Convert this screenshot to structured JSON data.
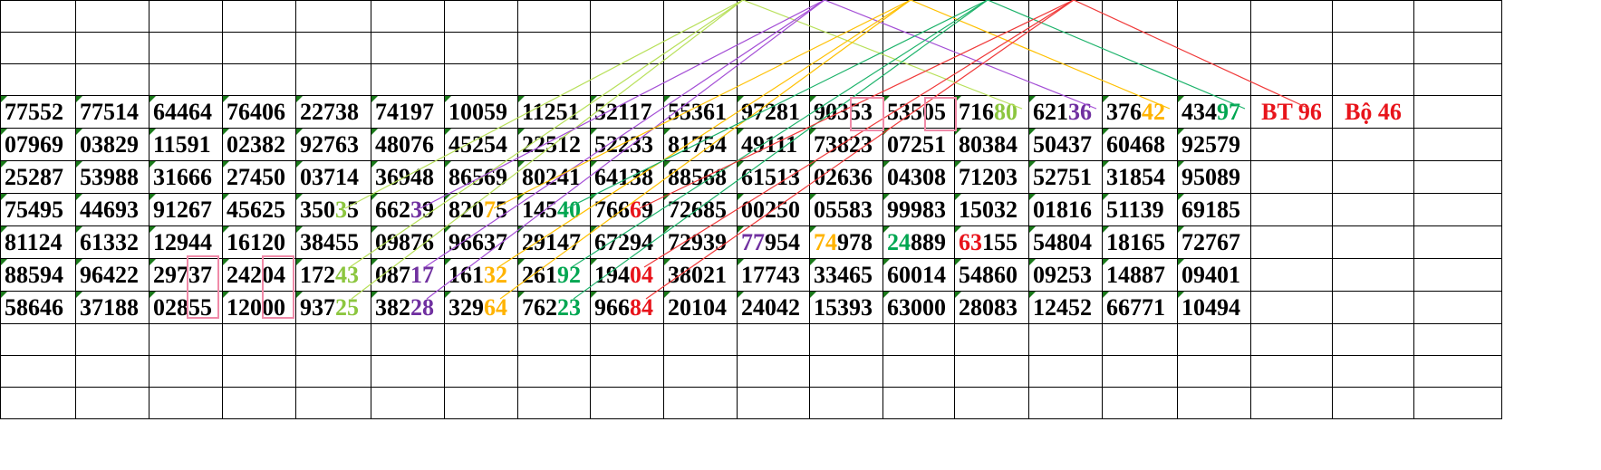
{
  "sheet": {
    "label_bt": "BT 96",
    "label_bo": "Bộ 46",
    "rows": [
      [
        [
          "77552"
        ],
        [
          "77514"
        ],
        [
          "64464"
        ],
        [
          "76406"
        ],
        [
          "22738"
        ],
        [
          "74197"
        ],
        [
          "10059"
        ],
        [
          "11251"
        ],
        [
          "52117"
        ],
        [
          "55361"
        ],
        [
          "97281"
        ],
        [
          "90353"
        ],
        [
          "53505"
        ],
        [
          "716",
          "80",
          "green"
        ],
        [
          "621",
          "36",
          "purple"
        ],
        [
          "376",
          "42",
          "orange"
        ],
        [
          "434",
          "97",
          "dkgreen"
        ]
      ],
      [
        [
          "07969"
        ],
        [
          "03829"
        ],
        [
          "11591"
        ],
        [
          "02382"
        ],
        [
          "92763"
        ],
        [
          "48076"
        ],
        [
          "45254"
        ],
        [
          "22512"
        ],
        [
          "52233"
        ],
        [
          "81754"
        ],
        [
          "49111"
        ],
        [
          "73823"
        ],
        [
          "07251"
        ],
        [
          "80384"
        ],
        [
          "50437"
        ],
        [
          "60468"
        ],
        [
          "92579"
        ]
      ],
      [
        [
          "25287"
        ],
        [
          "53988"
        ],
        [
          "31666"
        ],
        [
          "27450"
        ],
        [
          "03714"
        ],
        [
          "36948"
        ],
        [
          "86569"
        ],
        [
          "80241"
        ],
        [
          "64138"
        ],
        [
          "88568"
        ],
        [
          "61513"
        ],
        [
          "02636"
        ],
        [
          "04308"
        ],
        [
          "71203"
        ],
        [
          "52751"
        ],
        [
          "31854"
        ],
        [
          "95089"
        ]
      ],
      [
        [
          "75495"
        ],
        [
          "44693"
        ],
        [
          "91267"
        ],
        [
          "45625"
        ],
        [
          "350",
          "3",
          "green",
          "5"
        ],
        [
          "662",
          "3",
          "purple",
          "9"
        ],
        [
          "820",
          "7",
          "orange",
          "5"
        ],
        [
          "145",
          "40",
          "dkgreen"
        ],
        [
          "766",
          "6",
          "red",
          "9"
        ],
        [
          "72685"
        ],
        [
          "00250"
        ],
        [
          "05583"
        ],
        [
          "99983"
        ],
        [
          "15032"
        ],
        [
          "01816"
        ],
        [
          "51139"
        ],
        [
          "69185"
        ]
      ],
      [
        [
          "81124"
        ],
        [
          "61332"
        ],
        [
          "12944"
        ],
        [
          "16120"
        ],
        [
          "38455"
        ],
        [
          "09876"
        ],
        [
          "96637"
        ],
        [
          "29147"
        ],
        [
          "67294"
        ],
        [
          "72939"
        ],
        [
          "",
          "77",
          "purple",
          "954"
        ],
        [
          "",
          "74",
          "orange",
          "978"
        ],
        [
          "",
          "24",
          "dkgreen",
          "889"
        ],
        [
          "",
          "63",
          "red",
          "155"
        ],
        [
          "54804"
        ],
        [
          "18165"
        ],
        [
          "72767"
        ]
      ],
      [
        [
          "88594"
        ],
        [
          "96422"
        ],
        [
          "29737"
        ],
        [
          "24204"
        ],
        [
          "172",
          "43",
          "green"
        ],
        [
          "087",
          "17",
          "purple"
        ],
        [
          "161",
          "32",
          "orange"
        ],
        [
          "261",
          "92",
          "dkgreen"
        ],
        [
          "194",
          "04",
          "red"
        ],
        [
          "38021"
        ],
        [
          "17743"
        ],
        [
          "33465"
        ],
        [
          "60014"
        ],
        [
          "54860"
        ],
        [
          "09253"
        ],
        [
          "14887"
        ],
        [
          "09401"
        ]
      ],
      [
        [
          "58646"
        ],
        [
          "37188"
        ],
        [
          "02855"
        ],
        [
          "12000"
        ],
        [
          "937",
          "25",
          "green"
        ],
        [
          "382",
          "28",
          "purple"
        ],
        [
          "329",
          "64",
          "orange"
        ],
        [
          "762",
          "23",
          "dkgreen"
        ],
        [
          "966",
          "84",
          "red"
        ],
        [
          "20104"
        ],
        [
          "24042"
        ],
        [
          "15393"
        ],
        [
          "63000"
        ],
        [
          "28083"
        ],
        [
          "12452"
        ],
        [
          "66771"
        ],
        [
          "10494"
        ]
      ]
    ]
  },
  "colors": {
    "green": "#8cc63f",
    "purple": "#7030a0",
    "orange": "#ffb300",
    "dkgreen": "#00a651",
    "red": "#e8141b",
    "label": "#e8141b",
    "box": "#f08aa8"
  },
  "connectors": [
    {
      "color": "#b8e05a",
      "from": [
        "r0c16label"
      ]
    },
    {
      "color": "#a44fd6"
    },
    {
      "color": "#ffc000"
    },
    {
      "color": "#1db36b"
    },
    {
      "color": "#f03a3a"
    }
  ]
}
